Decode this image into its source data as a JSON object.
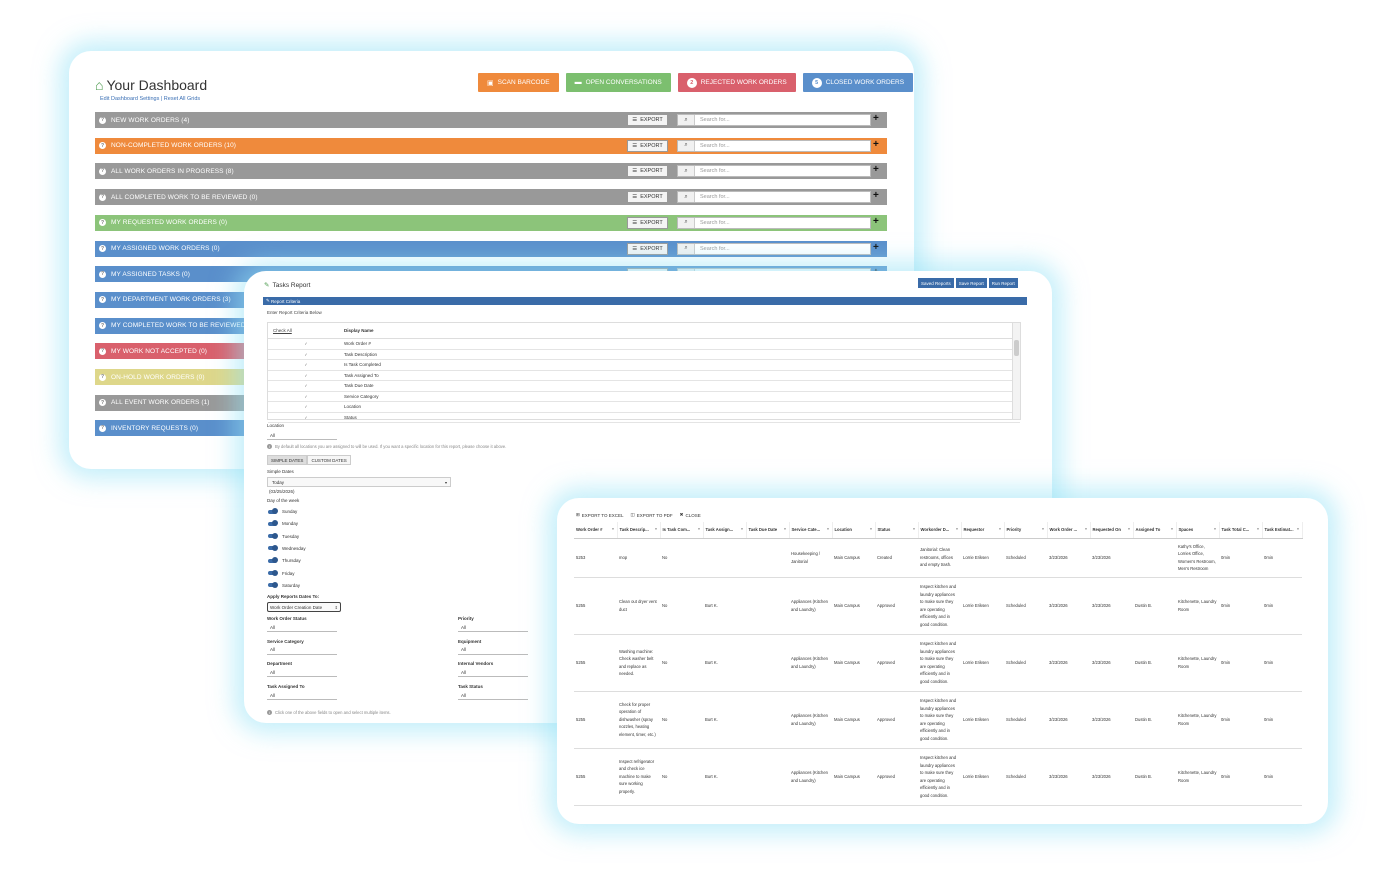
{
  "dashboard": {
    "title": "Your Dashboard",
    "links": "Edit Dashboard Settings | Reset All Grids",
    "buttons": [
      {
        "label": "SCAN BARCODE",
        "color": "#ef8a3c",
        "icon": "camera-icon"
      },
      {
        "label": "OPEN CONVERSATIONS",
        "color": "#7cbf6f",
        "icon": "chat-icon"
      },
      {
        "label": "REJECTED WORK ORDERS",
        "badge": "2",
        "color": "#d9606c"
      },
      {
        "label": "CLOSED WORK ORDERS",
        "badge": "5",
        "color": "#5a8fcb"
      }
    ],
    "export_label": "EXPORT",
    "search_placeholder": "Search for...",
    "rows": [
      {
        "label": "NEW WORK ORDERS (4)",
        "color": "#999999"
      },
      {
        "label": "NON-COMPLETED WORK ORDERS (10)",
        "color": "#ef8a3c"
      },
      {
        "label": "ALL WORK ORDERS IN PROGRESS (8)",
        "color": "#999999"
      },
      {
        "label": "ALL COMPLETED WORK TO BE REVIEWED (0)",
        "color": "#999999"
      },
      {
        "label": "MY REQUESTED WORK ORDERS (0)",
        "color": "#8cc47a"
      },
      {
        "label": "MY ASSIGNED WORK ORDERS (0)",
        "color": "#5a8fcb"
      },
      {
        "label": "MY ASSIGNED TASKS (0)",
        "color": "#5a8fcb"
      },
      {
        "label": "MY DEPARTMENT WORK ORDERS (3)",
        "color": "#5a8fcb"
      },
      {
        "label": "MY COMPLETED WORK TO BE REVIEWED",
        "color": "#5a8fcb"
      },
      {
        "label": "MY WORK NOT ACCEPTED (0)",
        "color": "#d9606c"
      },
      {
        "label": "ON-HOLD WORK ORDERS (0)",
        "color": "#ded78a"
      },
      {
        "label": "ALL EVENT WORK ORDERS (1)",
        "color": "#999999"
      },
      {
        "label": "INVENTORY REQUESTS (0)",
        "color": "#5a8fcb"
      }
    ]
  },
  "tasks": {
    "title": "Tasks Report",
    "buttons": [
      "Saved Reports",
      "Save Report",
      "Run Report"
    ],
    "criteria_bar": "Report Criteria",
    "enter_text": "Enter Report Criteria Below",
    "check_all": "Check All",
    "display_name": "Display Name",
    "fields": [
      "Work Order #",
      "Task Description",
      "Is Task Completed",
      "Task Assigned To",
      "Task Due Date",
      "Service Category",
      "Location",
      "Status"
    ],
    "location_label": "Location",
    "location_value": "All",
    "location_note": "By default all locations you are assigned to will be used. If you want a specific location for this report, please choose it above.",
    "tab_simple": "SIMPLE DATES",
    "tab_custom": "CUSTOM DATES",
    "simple_dates_label": "Simple Dates",
    "simple_dates_value": "Today",
    "date_text": "(03/25/2026)",
    "dow_label": "Day of the week",
    "days": [
      "Sunday",
      "Monday",
      "Tuesday",
      "Wednesday",
      "Thursday",
      "Friday",
      "Saturday"
    ],
    "apply_label": "Apply Reports Dates To:",
    "apply_value": "Work Order Creation Date",
    "filters_left": [
      {
        "label": "Work Order Status",
        "value": "All"
      },
      {
        "label": "Service Category",
        "value": "All"
      },
      {
        "label": "Department",
        "value": "All"
      },
      {
        "label": "Task Assigned To",
        "value": "All"
      }
    ],
    "filters_right": [
      {
        "label": "Priority",
        "value": "All"
      },
      {
        "label": "Equipment",
        "value": "All"
      },
      {
        "label": "Internal Vendors",
        "value": "All"
      },
      {
        "label": "Task Status",
        "value": "All"
      }
    ],
    "footer_note": "Click one of the above fields to open and select multiple items."
  },
  "results": {
    "toolbar": [
      "EXPORT TO EXCEL",
      "EXPORT TO PDF",
      "CLOSE"
    ],
    "columns": [
      "Work Order #",
      "Task Descrip...",
      "Is Task Com...",
      "Task Assign...",
      "Task Due Date",
      "Service Cate...",
      "Location",
      "Status",
      "Workorder D...",
      "Requestor",
      "Priority",
      "Work Order ...",
      "Requested On",
      "Assigned To",
      "Spaces",
      "Task Total C...",
      "Task Estimat..."
    ],
    "rows": [
      [
        "5253",
        "mop",
        "No",
        "",
        "",
        "Housekeeping / Janitorial",
        "Main Campus",
        "Created",
        "Janitorial: Clean restrooms, offices and empty trash.",
        "Lorrie Eriksen",
        "Scheduled",
        "3/23/2026",
        "3/23/2026",
        "",
        "Kathy's Office, Lorries Office, Women's Restroom, Men's Restroom",
        "0min",
        "0min"
      ],
      [
        "5255",
        "Clean out dryer vent duct",
        "No",
        "Burt K.",
        "",
        "Appliances (Kitchen and Laundry)",
        "Main Campus",
        "Approved",
        "Inspect kitchen and laundry appliances to make sure they are operating efficiently and in good condition.",
        "Lorrie Eriksen",
        "Scheduled",
        "3/23/2026",
        "3/23/2026",
        "Dustin B.",
        "Kitchenette, Laundry Room",
        "0min",
        "0min"
      ],
      [
        "5255",
        "Washing machine: Check washer belt and replace as needed.",
        "No",
        "Burt K.",
        "",
        "Appliances (Kitchen and Laundry)",
        "Main Campus",
        "Approved",
        "Inspect kitchen and laundry appliances to make sure they are operating efficiently and in good condition.",
        "Lorrie Eriksen",
        "Scheduled",
        "3/23/2026",
        "3/23/2026",
        "Dustin B.",
        "Kitchenette, Laundry Room",
        "0min",
        "0min"
      ],
      [
        "5255",
        "Check for proper operation of dishwasher (spray nozzles, heating element, timer, etc.)",
        "No",
        "Burt K.",
        "",
        "Appliances (Kitchen and Laundry)",
        "Main Campus",
        "Approved",
        "Inspect kitchen and laundry appliances to make sure they are operating efficiently and in good condition.",
        "Lorrie Eriksen",
        "Scheduled",
        "3/23/2026",
        "3/23/2026",
        "Dustin B.",
        "Kitchenette, Laundry Room",
        "0min",
        "0min"
      ],
      [
        "5255",
        "Inspect refrigerator and check ice machine to make sure working properly.",
        "No",
        "Burt K.",
        "",
        "Appliances (Kitchen and Laundry)",
        "Main Campus",
        "Approved",
        "Inspect kitchen and laundry appliances to make sure they are operating efficiently and in good condition.",
        "Lorrie Eriksen",
        "Scheduled",
        "3/23/2026",
        "3/23/2026",
        "Dustin B.",
        "Kitchenette, Laundry Room",
        "0min",
        "0min"
      ]
    ]
  }
}
